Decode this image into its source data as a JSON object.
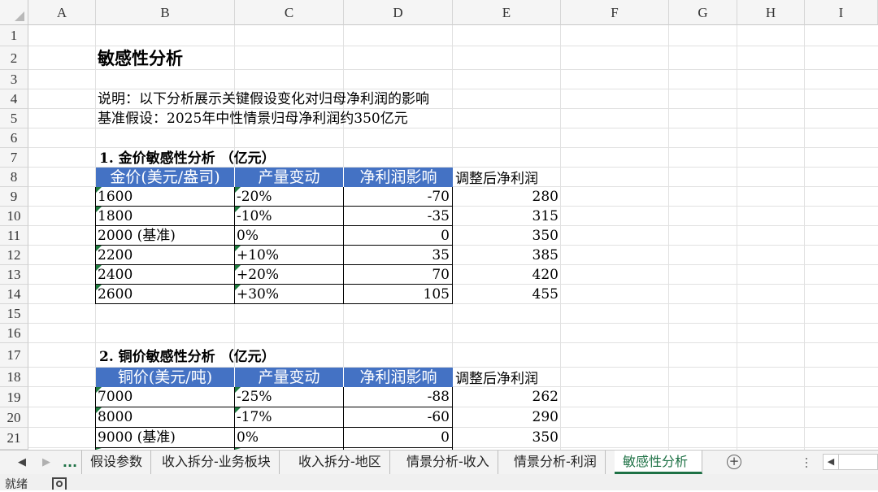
{
  "columns": [
    "A",
    "B",
    "C",
    "D",
    "E",
    "F",
    "G",
    "H",
    "I"
  ],
  "rows": [
    "1",
    "2",
    "3",
    "4",
    "5",
    "6",
    "7",
    "8",
    "9",
    "10",
    "11",
    "12",
    "13",
    "14",
    "15",
    "16",
    "17",
    "18",
    "19",
    "20",
    "21"
  ],
  "sheet": {
    "title": "敏感性分析",
    "note1": "说明：以下分析展示关键假设变化对归母净利润的影响",
    "note2": "基准假设：2025年中性情景归母净利润约350亿元",
    "gold": {
      "heading": "1.  金价敏感性分析 （亿元）",
      "headers": [
        "金价(美元/盎司)",
        "产量变动",
        "净利润影响"
      ],
      "extra_header": "调整后净利润",
      "rows": [
        {
          "price": "1600",
          "change": "-20%",
          "impact": "-70",
          "adjusted": "280"
        },
        {
          "price": "1800",
          "change": "-10%",
          "impact": "-35",
          "adjusted": "315"
        },
        {
          "price": "2000 (基准)",
          "change": "0%",
          "impact": "0",
          "adjusted": "350"
        },
        {
          "price": "2200",
          "change": "+10%",
          "impact": "35",
          "adjusted": "385"
        },
        {
          "price": "2400",
          "change": "+20%",
          "impact": "70",
          "adjusted": "420"
        },
        {
          "price": "2600",
          "change": "+30%",
          "impact": "105",
          "adjusted": "455"
        }
      ]
    },
    "copper": {
      "heading": "2.  铜价敏感性分析 （亿元）",
      "headers": [
        "铜价(美元/吨)",
        "产量变动",
        "净利润影响"
      ],
      "extra_header": "调整后净利润",
      "rows": [
        {
          "price": "7000",
          "change": "-25%",
          "impact": "-88",
          "adjusted": "262"
        },
        {
          "price": "8000",
          "change": "-17%",
          "impact": "-60",
          "adjusted": "290"
        },
        {
          "price": "9000 (基准)",
          "change": "0%",
          "impact": "0",
          "adjusted": "350"
        }
      ]
    }
  },
  "tabs": {
    "ellipsis": "...",
    "items": [
      "假设参数",
      "收入拆分-业务板块",
      "收入拆分-地区",
      "情景分析-收入",
      "情景分析-利润",
      "敏感性分析"
    ],
    "add": "+"
  },
  "status": {
    "ready": "就绪"
  },
  "colors": {
    "header_blue": "#4472c4",
    "accent_green": "#1e7145"
  }
}
